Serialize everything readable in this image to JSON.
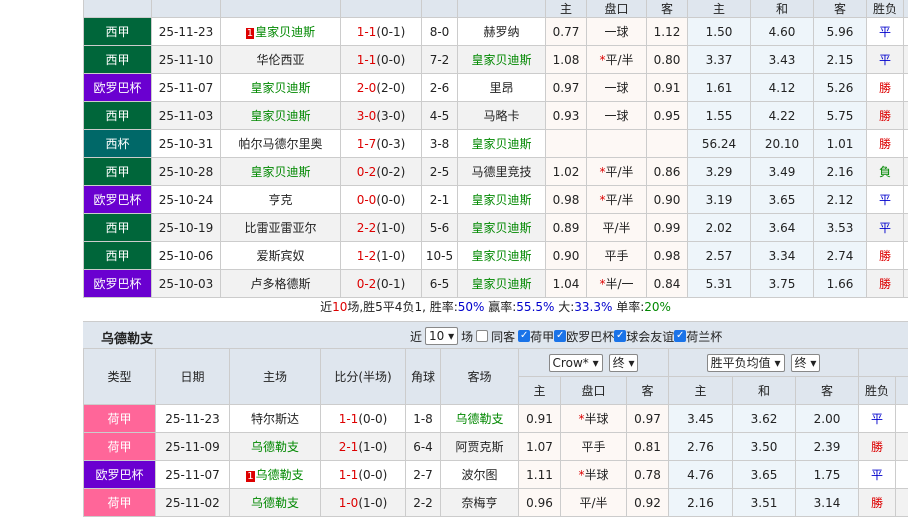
{
  "colors": {
    "西甲": "#00663a",
    "欧罗巴杯": "#6a00d0",
    "西杯": "#006868",
    "荷甲": "#ff6699"
  },
  "odds_headers": [
    "主",
    "盘口",
    "客",
    "主",
    "和",
    "客",
    "胜负"
  ],
  "team1": {
    "rows": [
      {
        "type": "西甲",
        "date": "25-11-23",
        "home": "皇家贝迪斯",
        "home_rank": "1",
        "home_hl": true,
        "score": "1-1",
        "half": "(0-1)",
        "corner": "8-0",
        "away": "赫罗纳",
        "away_hl": false,
        "o": [
          "0.77",
          "一球",
          "1.12",
          "1.50",
          "4.60",
          "5.96"
        ],
        "res": "平"
      },
      {
        "type": "西甲",
        "date": "25-11-10",
        "home": "华伦西亚",
        "home_hl": false,
        "score": "1-1",
        "half": "(0-0)",
        "corner": "7-2",
        "away": "皇家贝迪斯",
        "away_hl": true,
        "o": [
          "1.08",
          "*平/半",
          "0.80",
          "3.37",
          "3.43",
          "2.15"
        ],
        "res": "平"
      },
      {
        "type": "欧罗巴杯",
        "date": "25-11-07",
        "home": "皇家贝迪斯",
        "home_hl": true,
        "score": "2-0",
        "half": "(2-0)",
        "corner": "2-6",
        "away": "里昂",
        "away_hl": false,
        "o": [
          "0.97",
          "一球",
          "0.91",
          "1.61",
          "4.12",
          "5.26"
        ],
        "res": "勝"
      },
      {
        "type": "西甲",
        "date": "25-11-03",
        "home": "皇家贝迪斯",
        "home_hl": true,
        "score": "3-0",
        "half": "(3-0)",
        "corner": "4-5",
        "away": "马略卡",
        "away_hl": false,
        "o": [
          "0.93",
          "一球",
          "0.95",
          "1.55",
          "4.22",
          "5.75"
        ],
        "res": "勝"
      },
      {
        "type": "西杯",
        "date": "25-10-31",
        "home": "帕尔马德尔里奥",
        "home_hl": false,
        "score": "1-7",
        "half": "(0-3)",
        "corner": "3-8",
        "away": "皇家贝迪斯",
        "away_hl": true,
        "o": [
          "",
          "",
          "",
          "56.24",
          "20.10",
          "1.01"
        ],
        "res": "勝"
      },
      {
        "type": "西甲",
        "date": "25-10-28",
        "home": "皇家贝迪斯",
        "home_hl": true,
        "score": "0-2",
        "half": "(0-2)",
        "corner": "2-5",
        "away": "马德里竞技",
        "away_hl": false,
        "o": [
          "1.02",
          "*平/半",
          "0.86",
          "3.29",
          "3.49",
          "2.16"
        ],
        "res": "負"
      },
      {
        "type": "欧罗巴杯",
        "date": "25-10-24",
        "home": "亨克",
        "home_hl": false,
        "score": "0-0",
        "half": "(0-0)",
        "corner": "2-1",
        "away": "皇家贝迪斯",
        "away_hl": true,
        "o": [
          "0.98",
          "*平/半",
          "0.90",
          "3.19",
          "3.65",
          "2.12"
        ],
        "res": "平"
      },
      {
        "type": "西甲",
        "date": "25-10-19",
        "home": "比雷亚雷亚尔",
        "home_hl": false,
        "score": "2-2",
        "half": "(1-0)",
        "corner": "5-6",
        "away": "皇家贝迪斯",
        "away_hl": true,
        "o": [
          "0.89",
          "平/半",
          "0.99",
          "2.02",
          "3.64",
          "3.53"
        ],
        "res": "平"
      },
      {
        "type": "西甲",
        "date": "25-10-06",
        "home": "爱斯宾奴",
        "home_hl": false,
        "score": "1-2",
        "half": "(1-0)",
        "corner": "10-5",
        "away": "皇家贝迪斯",
        "away_hl": true,
        "o": [
          "0.90",
          "平手",
          "0.98",
          "2.57",
          "3.34",
          "2.74"
        ],
        "res": "勝"
      },
      {
        "type": "欧罗巴杯",
        "date": "25-10-03",
        "home": "卢多格德斯",
        "home_hl": false,
        "score": "0-2",
        "half": "(0-1)",
        "corner": "6-5",
        "away": "皇家贝迪斯",
        "away_hl": true,
        "o": [
          "1.04",
          "*半/一",
          "0.84",
          "5.31",
          "3.75",
          "1.66"
        ],
        "res": "勝"
      }
    ]
  },
  "summary": {
    "p1": "近",
    "n": "10",
    "p2": "场,胜5平4负1, 胜率:",
    "win": "50%",
    "p3": " 赢率:",
    "ying": "55.5%",
    "p4": " 大:",
    "da": "33.3%",
    "p5": " 单率:",
    "dan": "20%"
  },
  "team2": {
    "title": "乌德勒支",
    "near": "近",
    "count": "10",
    "chang": "场",
    "same": "同客",
    "filters": [
      "荷甲",
      "欧罗巴杯",
      "球会友谊",
      "荷兰杯"
    ],
    "headers": [
      "类型",
      "日期",
      "主场",
      "比分(半场)",
      "角球",
      "客场"
    ],
    "company": "Crow*",
    "final1": "终",
    "avg": "胜平负均值",
    "final2": "终",
    "rows": [
      {
        "type": "荷甲",
        "date": "25-11-23",
        "home": "特尔斯达",
        "home_hl": false,
        "score": "1-1",
        "half": "(0-0)",
        "corner": "1-8",
        "away": "乌德勒支",
        "away_hl": true,
        "o": [
          "0.91",
          "*半球",
          "0.97",
          "3.45",
          "3.62",
          "2.00"
        ],
        "res": "平"
      },
      {
        "type": "荷甲",
        "date": "25-11-09",
        "home": "乌德勒支",
        "home_hl": true,
        "score": "2-1",
        "half": "(1-0)",
        "corner": "6-4",
        "away": "阿贾克斯",
        "away_hl": false,
        "o": [
          "1.07",
          "平手",
          "0.81",
          "2.76",
          "3.50",
          "2.39"
        ],
        "res": "勝"
      },
      {
        "type": "欧罗巴杯",
        "date": "25-11-07",
        "home": "乌德勒支",
        "home_rank": "1",
        "home_hl": true,
        "score": "1-1",
        "half": "(0-0)",
        "corner": "2-7",
        "away": "波尔图",
        "away_hl": false,
        "o": [
          "1.11",
          "*半球",
          "0.78",
          "4.76",
          "3.65",
          "1.75"
        ],
        "res": "平"
      },
      {
        "type": "荷甲",
        "date": "25-11-02",
        "home": "乌德勒支",
        "home_hl": true,
        "score": "1-0",
        "half": "(1-0)",
        "corner": "2-2",
        "away": "奈梅亨",
        "away_hl": false,
        "o": [
          "0.96",
          "平/半",
          "0.92",
          "2.16",
          "3.51",
          "3.14"
        ],
        "res": "勝"
      }
    ]
  }
}
